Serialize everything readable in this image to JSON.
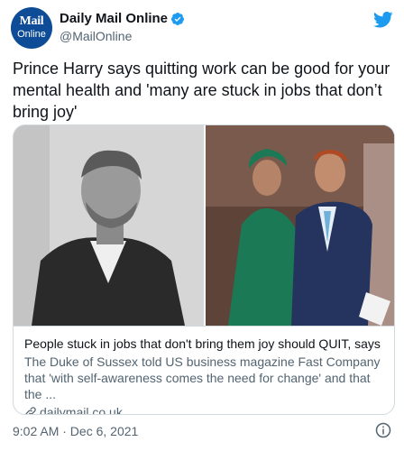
{
  "account": {
    "display_name": "Daily Mail Online",
    "handle": "@MailOnline",
    "avatar_logo_top": "Mail",
    "avatar_logo_bottom": "Online",
    "avatar_color": "#0e4c97",
    "verified": true,
    "verified_icon": "verified-badge-icon",
    "verified_color": "#1d9bf0"
  },
  "platform_icon": "twitter-bird-icon",
  "platform_color": "#1d9bf0",
  "tweet": {
    "text": "Prince Harry says quitting work can be good for your mental health and 'many are stuck in jobs that don’t bring joy'"
  },
  "card": {
    "title": "People stuck in jobs that don't bring them joy should QUIT, says ...",
    "description": "The Duke of Sussex told US business magazine Fast Company that 'with self-awareness comes the need for change' and that the ...",
    "domain": "dailymail.co.uk",
    "domain_icon": "link-icon",
    "images": [
      "black-and-white-portrait-photo",
      "couple-walking-photo"
    ]
  },
  "footer": {
    "timestamp": "9:02 AM · Dec 6, 2021",
    "info_icon": "info-icon"
  }
}
